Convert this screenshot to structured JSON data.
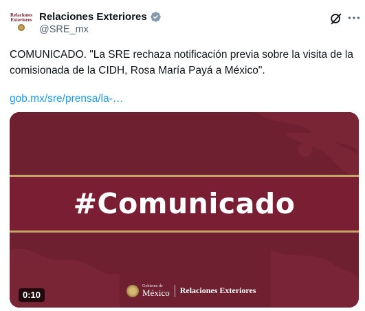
{
  "author": {
    "display_name": "Relaciones Exteriores",
    "handle": "@SRE_mx",
    "avatar_text_1": "Relaciones",
    "avatar_text_2": "Exteriores",
    "verified_color": "#829aab"
  },
  "post": {
    "text": "COMUNICADO. \"La SRE rechaza notificación previa sobre la visita de la comisionada de la CIDH, Rosa María Payá a México\".",
    "link_text": "gob.mx/sre/prensa/la-…",
    "link_color": "#1d9bf0"
  },
  "media": {
    "title": "#Comunicado",
    "footer_gov_small": "Gobierno de",
    "footer_gov_big": "México",
    "footer_sre": "Relaciones Exteriores",
    "duration": "0:10",
    "background_color": "#6e1f30",
    "band_color": "#7a1f33",
    "accent_color": "#c8a56a"
  },
  "icons": {
    "grok": "grok-icon",
    "more": "more-icon",
    "verified": "verified-badge-icon"
  }
}
